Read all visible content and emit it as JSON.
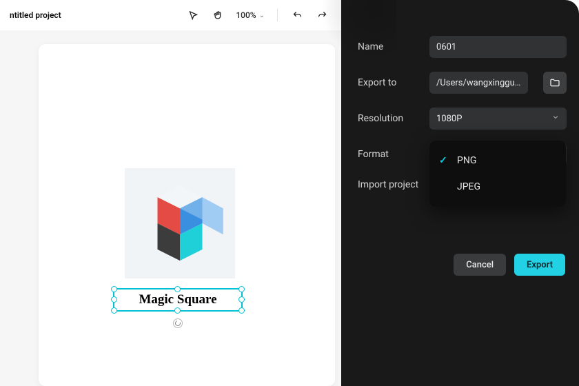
{
  "topbar": {
    "project_title": "ntitled project",
    "zoom_label": "100%"
  },
  "canvas": {
    "text_layer_content": "Magic Square"
  },
  "export": {
    "labels": {
      "name": "Name",
      "export_to": "Export to",
      "resolution": "Resolution",
      "format": "Format",
      "import_project": "Import project"
    },
    "values": {
      "name": "0601",
      "export_to": "/Users/wangxingguo/...",
      "resolution": "1080P",
      "format": "PNG"
    },
    "format_options": [
      {
        "label": "PNG",
        "selected": true
      },
      {
        "label": "JPEG",
        "selected": false
      }
    ],
    "buttons": {
      "cancel": "Cancel",
      "export": "Export"
    }
  }
}
